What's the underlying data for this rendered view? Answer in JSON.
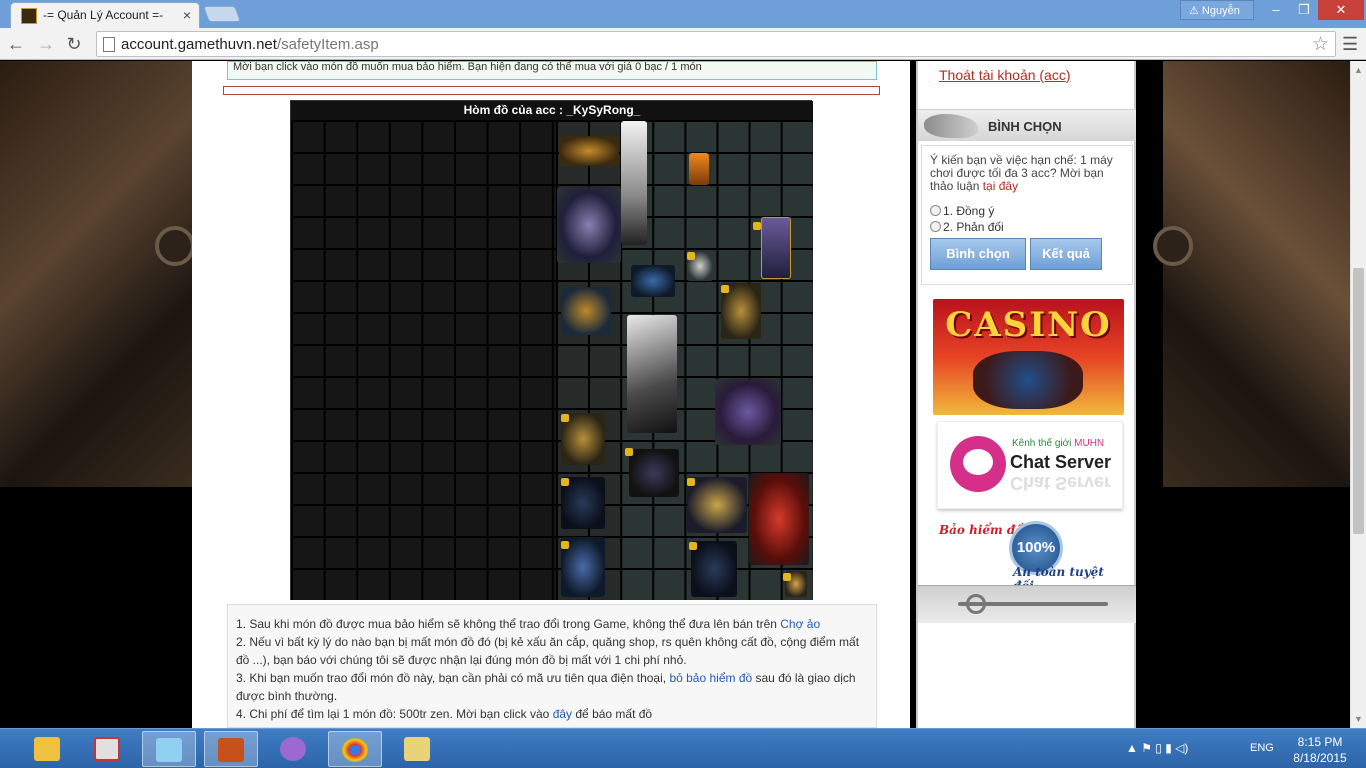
{
  "window": {
    "tab_title": "-= Quản Lý Account =-",
    "user": "Nguyễn",
    "minimize": "–",
    "restore": "❐",
    "close": "✕"
  },
  "browser": {
    "url_host": "account.gamethuvn.net",
    "url_path": "/safetyItem.asp",
    "back": "←",
    "forward": "→",
    "reload": "↻",
    "star": "☆",
    "menu": "☰"
  },
  "page": {
    "notice": "Mời bạn click vào món đồ muốn mua bảo hiểm. Bạn hiện đang có thể mua với giá 0 bạc / 1 món",
    "inventory_title": "Hòm đồ của acc : _KySyRong_",
    "rules": {
      "r1": "1. Sau khi món đồ được mua bảo hiểm sẽ không thể trao đổi trong Game, không thể đưa lên bán trên ",
      "r1_link": "Chợ ảo",
      "r2": "2. Nếu vì bất kỳ lý do nào bạn bị mất món đồ đó (bị kẻ xấu ăn cắp, quăng shop, rs quên không cất đồ, cộng điểm mất đồ ...), bạn báo với chúng tôi sẽ được nhận lại đúng món đồ bị mất với 1 chi phí nhỏ.",
      "r3": "3. Khi bạn muốn trao đổi món đồ này, bạn cần phải có mã ưu tiên qua điện thoại, ",
      "r3_link": "bỏ bảo hiểm đồ",
      "r3_tail": " sau đó là giao dịch được bình thường.",
      "r4": "4. Chi phí để tìm lại 1 món đồ: 500tr zen. Mời bạn click vào ",
      "r4_link": "đây",
      "r4_tail": " để báo mất đồ"
    }
  },
  "sidebar": {
    "logout": "Thoát tài khoản (acc)",
    "vote_heading": "BÌNH CHỌN",
    "vote_question": "Ý kiến bạn về việc hạn chế: 1 máy chơi được tối đa 3 acc? Mời bạn thảo luận ",
    "vote_link": "tại đây",
    "option1": "1. Đồng ý",
    "option2": "2. Phản đối",
    "vote_button": "Bình chọn",
    "result_button": "Kết quả",
    "casino": "CASINO",
    "chat_kenh": "Kênh thế giới ",
    "chat_muhn": "MUHN",
    "chat_server": "Chat Server",
    "ins_a": "Bảo hiểm đồ",
    "ins_seal": "100%",
    "ins_b": "An toàn tuyệt đối"
  },
  "taskbar": {
    "tray": "▲  ⚑  ▯  ▮  ◁)",
    "lang": "ENG",
    "time": "8:15 PM",
    "date": "8/18/2015"
  }
}
